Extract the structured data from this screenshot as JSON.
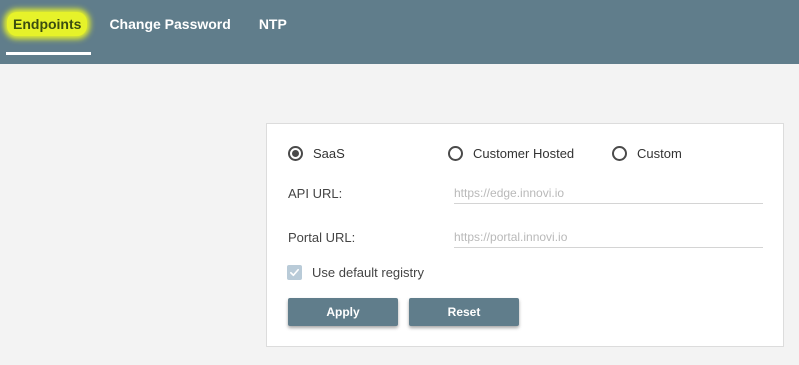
{
  "tabs": [
    {
      "label": "Endpoints",
      "active": true
    },
    {
      "label": "Change Password",
      "active": false
    },
    {
      "label": "NTP",
      "active": false
    }
  ],
  "colors": {
    "header": "#607d8b",
    "highlight": "#e6f22a",
    "button": "#607d8b"
  },
  "endpoint_type": {
    "options": [
      {
        "label": "SaaS",
        "selected": true
      },
      {
        "label": "Customer Hosted",
        "selected": false
      },
      {
        "label": "Custom",
        "selected": false
      }
    ]
  },
  "fields": {
    "api_url": {
      "label": "API URL:",
      "value": "",
      "placeholder": "https://edge.innovi.io"
    },
    "portal_url": {
      "label": "Portal URL:",
      "value": "",
      "placeholder": "https://portal.innovi.io"
    }
  },
  "use_default_registry": {
    "label": "Use default registry",
    "checked": true,
    "icon": "check-icon"
  },
  "buttons": {
    "apply": "Apply",
    "reset": "Reset"
  }
}
